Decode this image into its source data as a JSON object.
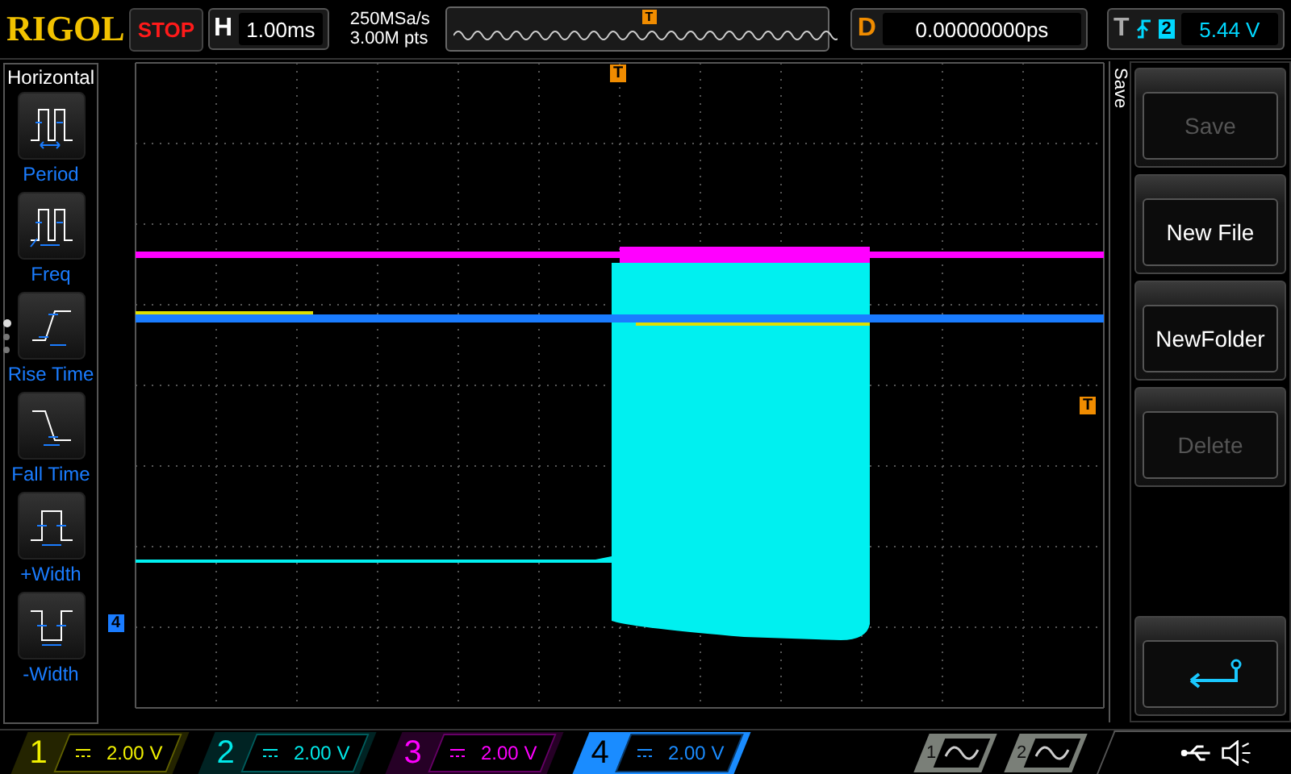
{
  "brand": "RIGOL",
  "run_state": "STOP",
  "horizontal": {
    "label": "H",
    "value": "1.00ms"
  },
  "sample_rate": "250MSa/s",
  "memory_depth": "3.00M pts",
  "overview": {
    "marker": "T"
  },
  "delay": {
    "label": "D",
    "value": "0.00000000ps"
  },
  "trigger": {
    "label": "T",
    "source": "2",
    "level": "5.44 V"
  },
  "measure_menu": {
    "title": "Horizontal",
    "items": [
      {
        "label": "Period",
        "kind": "period"
      },
      {
        "label": "Freq",
        "kind": "freq"
      },
      {
        "label": "Rise Time",
        "kind": "rise"
      },
      {
        "label": "Fall Time",
        "kind": "fall"
      },
      {
        "label": "+Width",
        "kind": "pwidth"
      },
      {
        "label": "-Width",
        "kind": "nwidth"
      }
    ],
    "pages": [
      {
        "selected": true
      },
      {
        "selected": false
      },
      {
        "selected": false
      }
    ]
  },
  "markers": {
    "trigger_position": "T",
    "trigger_level": "T",
    "channel": "4"
  },
  "softkeys": {
    "title": "Save",
    "buttons": [
      {
        "kind": "text",
        "label": "Save",
        "disabled": true
      },
      {
        "kind": "text",
        "label": "New File",
        "disabled": false
      },
      {
        "kind": "text",
        "label": "NewFolder",
        "disabled": false
      },
      {
        "kind": "text",
        "label": "Delete",
        "disabled": true
      },
      {
        "kind": "back"
      }
    ]
  },
  "channels": [
    {
      "number": "1",
      "scale": "2.00 V",
      "color": "#f0f000",
      "selected": false
    },
    {
      "number": "2",
      "scale": "2.00 V",
      "color": "#00e8e8",
      "selected": false
    },
    {
      "number": "3",
      "scale": "2.00 V",
      "color": "#ff00ff",
      "selected": false
    },
    {
      "number": "4",
      "scale": "2.00 V",
      "color": "#1a8cff",
      "selected": true
    }
  ],
  "generators": [
    {
      "number": "1"
    },
    {
      "number": "2"
    }
  ]
}
